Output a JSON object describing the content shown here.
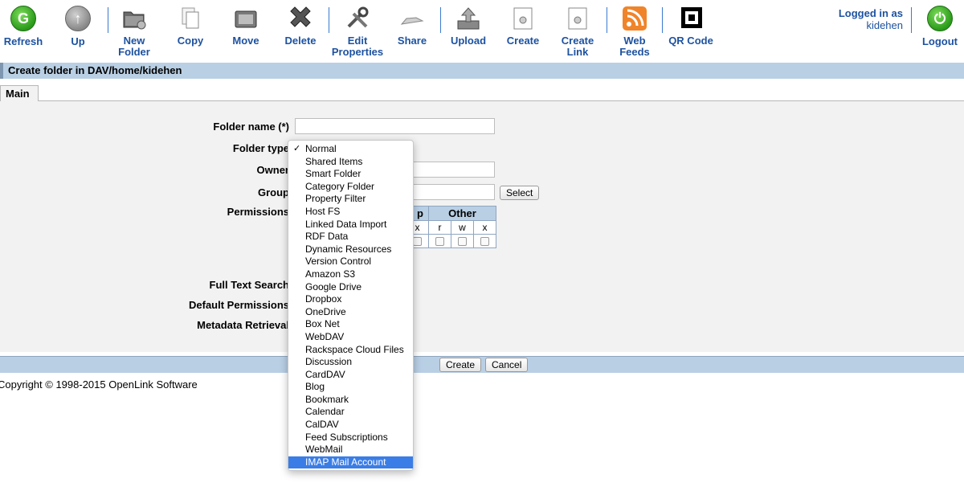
{
  "toolbar": {
    "buttons": [
      {
        "label": "Refresh"
      },
      {
        "label": "Up"
      },
      {
        "label": "New Folder"
      },
      {
        "label": "Copy"
      },
      {
        "label": "Move"
      },
      {
        "label": "Delete"
      },
      {
        "label": "Edit Properties"
      },
      {
        "label": "Share"
      },
      {
        "label": "Upload"
      },
      {
        "label": "Create"
      },
      {
        "label": "Create Link"
      },
      {
        "label": "Web Feeds"
      },
      {
        "label": "QR Code"
      },
      {
        "label": "Logout"
      }
    ],
    "logged_in_label": "Logged in as",
    "username": "kidehen"
  },
  "title": "Create folder in DAV/home/kidehen",
  "tabs": [
    {
      "label": "Main"
    }
  ],
  "form": {
    "folder_name_label": "Folder name (*)",
    "folder_type_label": "Folder type",
    "owner_label": "Owner",
    "group_label": "Group",
    "permissions_label": "Permissions",
    "full_text_search_label": "Full Text Search",
    "default_permissions_label": "Default Permissions",
    "metadata_retrieval_label": "Metadata Retrieval",
    "select_button": "Select",
    "perm_group_header": "p",
    "perm_other_header": "Other",
    "perm_cols": [
      "x",
      "r",
      "w",
      "x"
    ]
  },
  "actions": {
    "create_label": "Create",
    "cancel_label": "Cancel"
  },
  "footer": {
    "copyright": "Copyright © 1998-2015 OpenLink Software"
  },
  "dropdown": {
    "check_mark": "✓",
    "checked_index": 0,
    "highlighted_index": 25,
    "options": [
      "Normal",
      "Shared Items",
      "Smart Folder",
      "Category Folder",
      "Property Filter",
      "Host FS",
      "Linked Data Import",
      "RDF Data",
      "Dynamic Resources",
      "Version Control",
      "Amazon S3",
      "Google Drive",
      "Dropbox",
      "OneDrive",
      "Box Net",
      "WebDAV",
      "Rackspace Cloud Files",
      "Discussion",
      "CardDAV",
      "Blog",
      "Bookmark",
      "Calendar",
      "CalDAV",
      "Feed Subscriptions",
      "WebMail",
      "IMAP Mail Account"
    ]
  },
  "colors": {
    "link_blue": "#1d52a0",
    "bar_blue": "#b9cfe4",
    "selection_blue": "#3a7de6"
  }
}
